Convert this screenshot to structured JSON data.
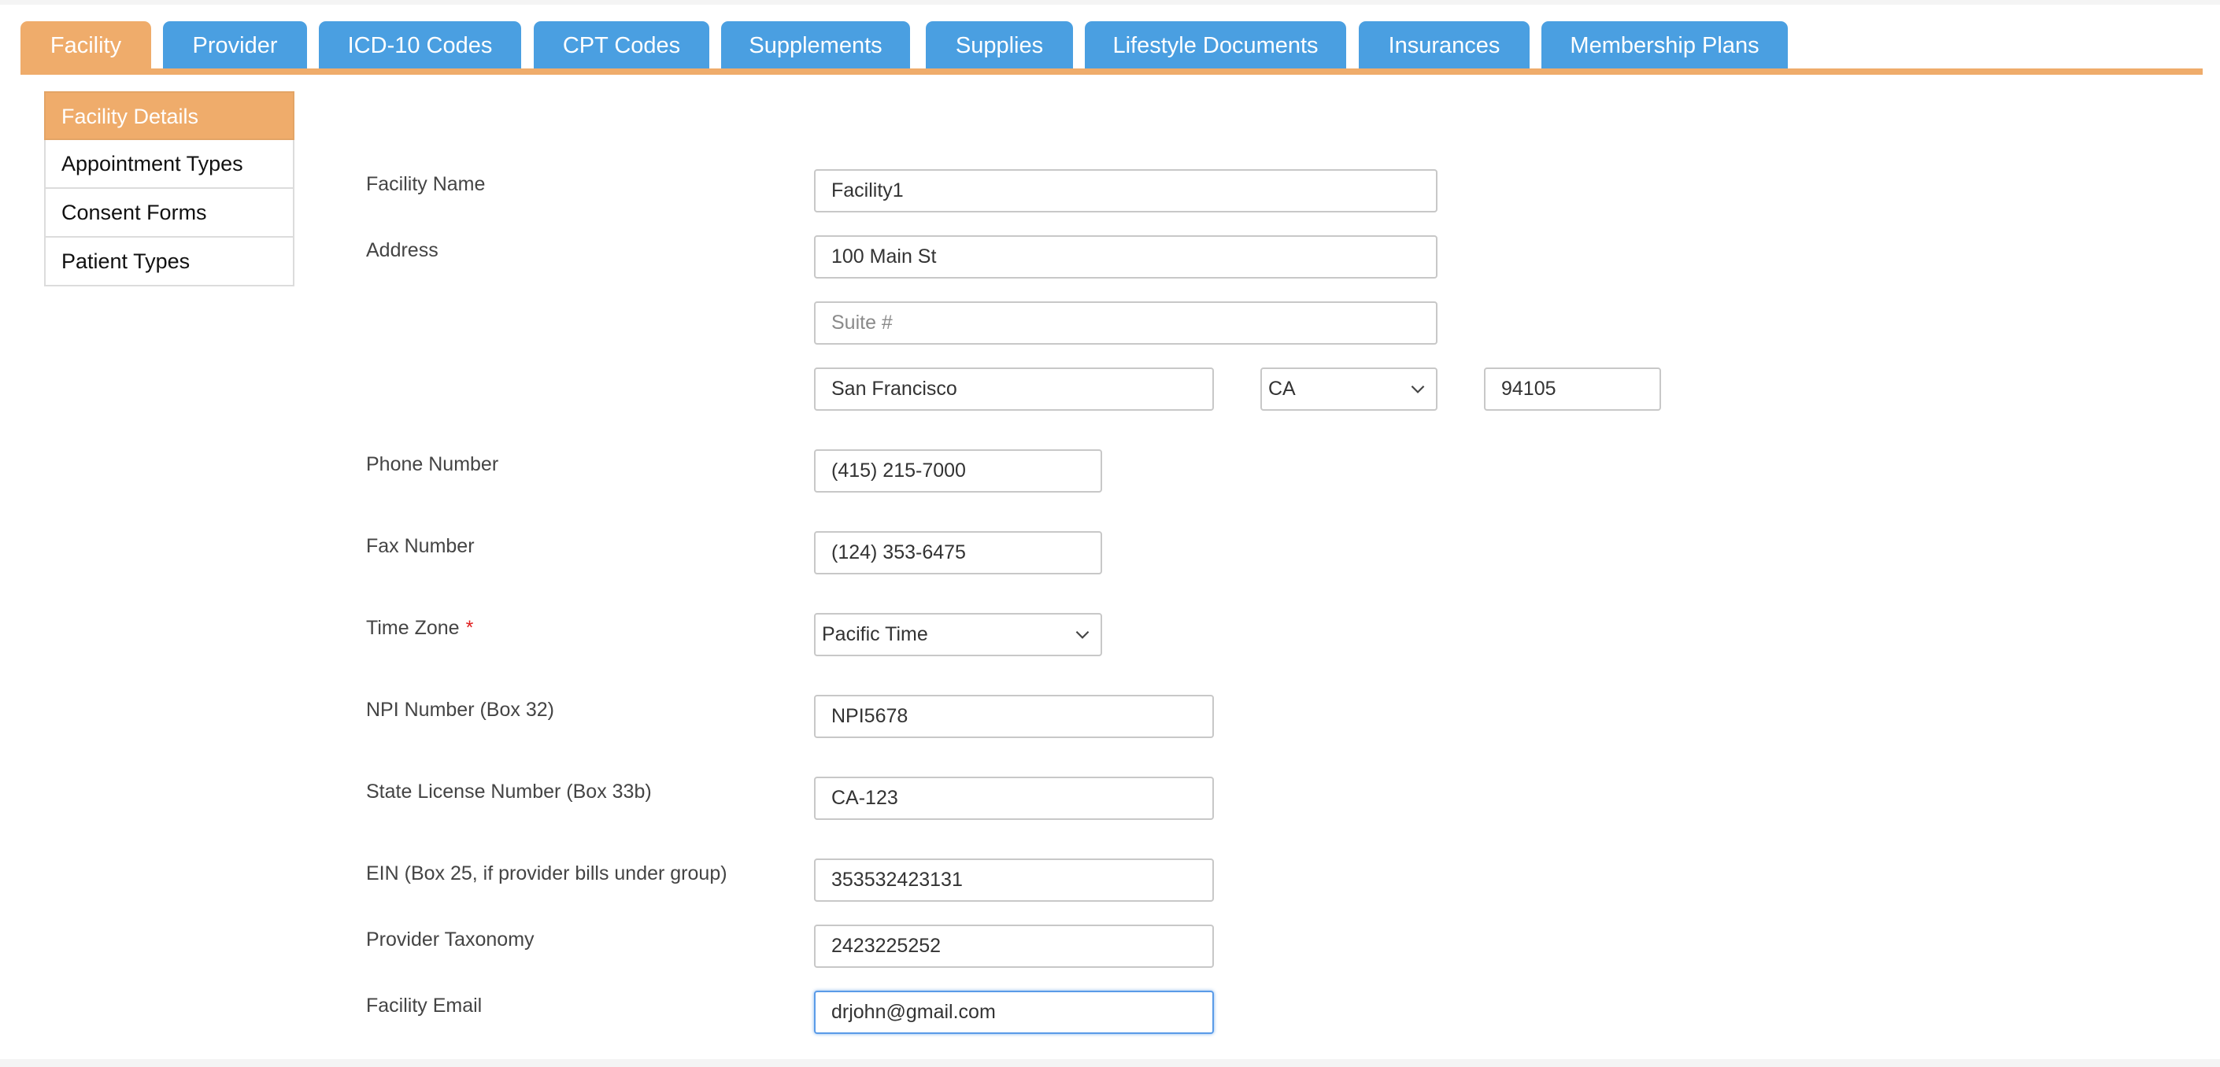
{
  "tabs": [
    {
      "label": "Facility",
      "active": true
    },
    {
      "label": "Provider"
    },
    {
      "label": "ICD-10 Codes"
    },
    {
      "label": "CPT Codes"
    },
    {
      "label": "Supplements"
    },
    {
      "label": "Supplies"
    },
    {
      "label": "Lifestyle Documents"
    },
    {
      "label": "Insurances"
    },
    {
      "label": "Membership Plans"
    }
  ],
  "sidebar": {
    "items": [
      {
        "label": "Facility Details",
        "active": true
      },
      {
        "label": "Appointment Types"
      },
      {
        "label": "Consent Forms"
      },
      {
        "label": "Patient Types"
      }
    ]
  },
  "form": {
    "facility_name": {
      "label": "Facility Name",
      "value": "Facility1"
    },
    "address": {
      "label": "Address",
      "street": "100 Main St",
      "suite_placeholder": "Suite #",
      "city": "San Francisco",
      "state": "CA",
      "zip": "94105"
    },
    "phone": {
      "label": "Phone Number",
      "value": "(415) 215-7000"
    },
    "fax": {
      "label": "Fax Number",
      "value": "(124) 353-6475"
    },
    "time_zone": {
      "label": "Time Zone",
      "required_mark": "*",
      "value": "Pacific Time"
    },
    "npi": {
      "label": "NPI Number (Box 32)",
      "value": "NPI5678"
    },
    "state_license": {
      "label": "State License Number (Box 33b)",
      "value": "CA-123"
    },
    "ein": {
      "label": "EIN (Box 25, if provider bills under group)",
      "value": "353532423131"
    },
    "taxonomy": {
      "label": "Provider Taxonomy",
      "value": "2423225252"
    },
    "email": {
      "label": "Facility Email",
      "value": "drjohn@gmail.com"
    }
  },
  "colors": {
    "tab_blue": "#4a9fe1",
    "accent_orange": "#efac6b",
    "focus_blue": "#5a9be8",
    "required_red": "#e02020"
  },
  "icons": {
    "select_chevron": "chevron-down-icon"
  }
}
